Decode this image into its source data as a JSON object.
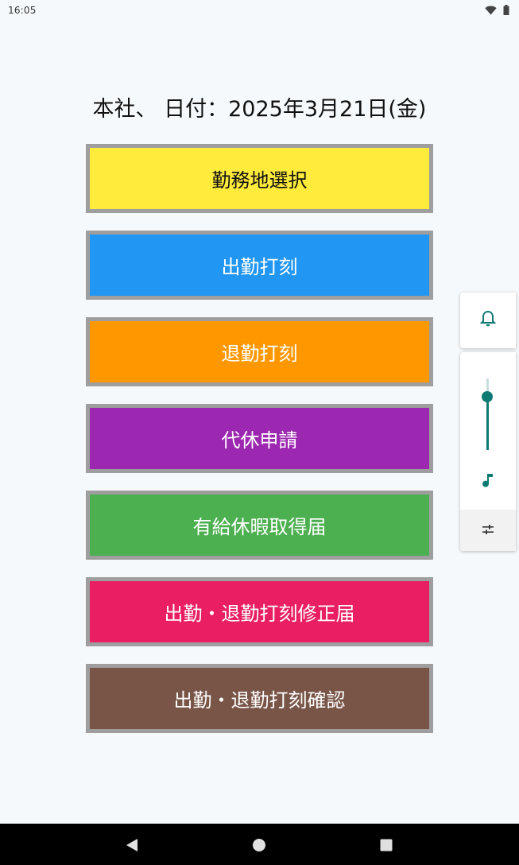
{
  "status_bar": {
    "time": "16:05",
    "icons": [
      "wifi-icon",
      "battery-icon"
    ]
  },
  "header": {
    "title": "本社、 日付：2025年3月21日(金)"
  },
  "menu": {
    "buttons": [
      {
        "label": "勤務地選択",
        "color": "#ffeb3b"
      },
      {
        "label": "出勤打刻",
        "color": "#2196f3"
      },
      {
        "label": "退勤打刻",
        "color": "#ff9800"
      },
      {
        "label": "代休申請",
        "color": "#9c27b0"
      },
      {
        "label": "有給休暇取得届",
        "color": "#4caf50"
      },
      {
        "label": "出勤・退勤打刻修正届",
        "color": "#e91e63"
      },
      {
        "label": "出勤・退勤打刻確認",
        "color": "#795548"
      }
    ]
  },
  "volume_panel": {
    "level": 0.74,
    "icons": [
      "bell-icon",
      "music-note-icon",
      "equalizer-settings-icon"
    ],
    "accent_color": "#0e7a74"
  },
  "nav_bar": {
    "icons": [
      "back-icon",
      "home-icon",
      "recents-icon"
    ]
  }
}
